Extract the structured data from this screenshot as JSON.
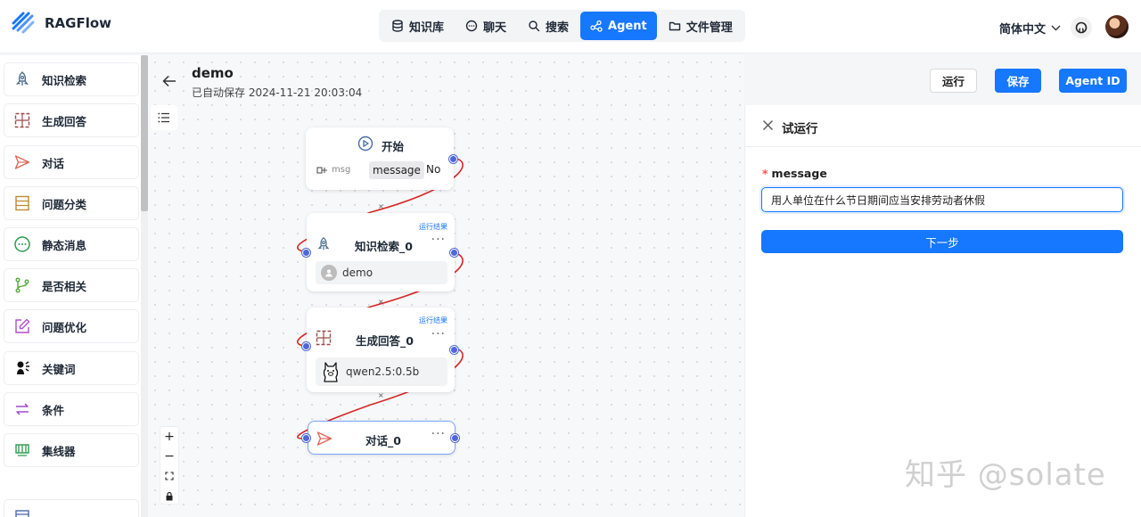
{
  "app": {
    "name": "RAGFlow"
  },
  "nav": {
    "items": [
      {
        "label": "知识库",
        "icon": "database-icon"
      },
      {
        "label": "聊天",
        "icon": "chat-icon"
      },
      {
        "label": "搜索",
        "icon": "search-icon"
      },
      {
        "label": "Agent",
        "icon": "graph-icon",
        "active": true
      },
      {
        "label": "文件管理",
        "icon": "folder-icon"
      }
    ]
  },
  "header_right": {
    "language": "简体中文"
  },
  "sidebar": {
    "items": [
      {
        "label": "知识检索",
        "icon": "rocket-icon"
      },
      {
        "label": "生成回答",
        "icon": "generate-icon"
      },
      {
        "label": "对话",
        "icon": "send-icon"
      },
      {
        "label": "问题分类",
        "icon": "list-icon"
      },
      {
        "label": "静态消息",
        "icon": "message-icon"
      },
      {
        "label": "是否相关",
        "icon": "branch-icon"
      },
      {
        "label": "问题优化",
        "icon": "edit-icon"
      },
      {
        "label": "关键词",
        "icon": "keyword-icon"
      },
      {
        "label": "条件",
        "icon": "switch-icon"
      },
      {
        "label": "集线器",
        "icon": "hub-icon"
      }
    ]
  },
  "flow": {
    "name": "demo",
    "saved_text": "已自动保存 2024-11-21 20:03:04",
    "run_label": "运行",
    "save_label": "保存",
    "agent_id_label": "Agent ID"
  },
  "nodes": {
    "begin": {
      "title": "开始",
      "param_icon_label": "msg",
      "param_name": "message",
      "param_flag": "No"
    },
    "retrieval": {
      "title": "知识检索_0",
      "run_result": "运行结果",
      "kb": "demo"
    },
    "generate": {
      "title": "生成回答_0",
      "run_result": "运行结果",
      "model": "qwen2.5:0.5b"
    },
    "answer": {
      "title": "对话_0"
    }
  },
  "zoom": {
    "plus": "+",
    "minus": "−"
  },
  "panel": {
    "title": "试运行",
    "field_label": "message",
    "field_value": "用人单位在什么节日期间应当安排劳动者休假",
    "next_label": "下一步"
  },
  "watermark": "知乎 @solate",
  "colors": {
    "accent": "#1677ff",
    "edge": "#d62828",
    "handle": "#4f67d8"
  }
}
